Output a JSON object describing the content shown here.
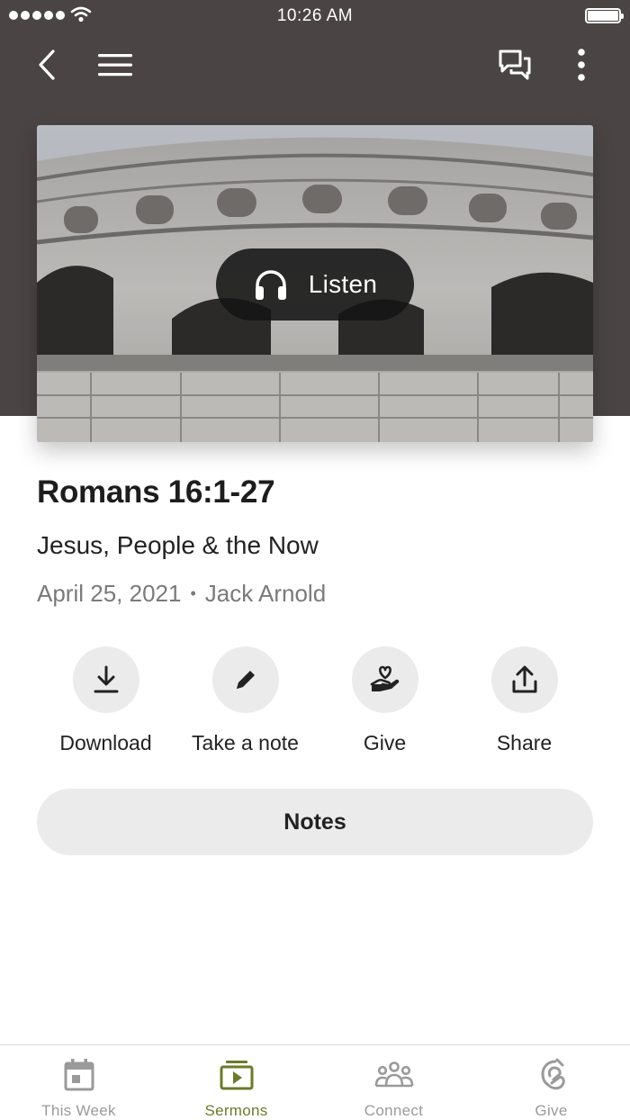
{
  "status_bar": {
    "time": "10:26 AM"
  },
  "nav": {
    "back_icon": "chevron-left-icon",
    "menu_icon": "hamburger-icon",
    "chat_icon": "chat-bubbles-icon",
    "more_icon": "more-vertical-icon"
  },
  "hero": {
    "listen_label": "Listen",
    "listen_icon": "headphones-icon"
  },
  "sermon": {
    "title": "Romans 16:1-27",
    "subtitle": "Jesus, People & the Now",
    "date": "April 25, 2021",
    "separator": "•",
    "speaker": "Jack Arnold"
  },
  "actions": [
    {
      "label": "Download",
      "icon": "download-icon"
    },
    {
      "label": "Take a note",
      "icon": "pencil-icon"
    },
    {
      "label": "Give",
      "icon": "heart-hand-icon"
    },
    {
      "label": "Share",
      "icon": "share-icon"
    }
  ],
  "notes_button": "Notes",
  "tabs": [
    {
      "label": "This Week",
      "icon": "calendar-icon",
      "active": false
    },
    {
      "label": "Sermons",
      "icon": "play-video-icon",
      "active": true
    },
    {
      "label": "Connect",
      "icon": "people-icon",
      "active": false
    },
    {
      "label": "Give",
      "icon": "give-icon",
      "active": false
    }
  ],
  "colors": {
    "header_bg": "#4a4544",
    "accent": "#6c7a2a",
    "inactive": "#9a9a9a",
    "button_bg": "#ebebec"
  }
}
